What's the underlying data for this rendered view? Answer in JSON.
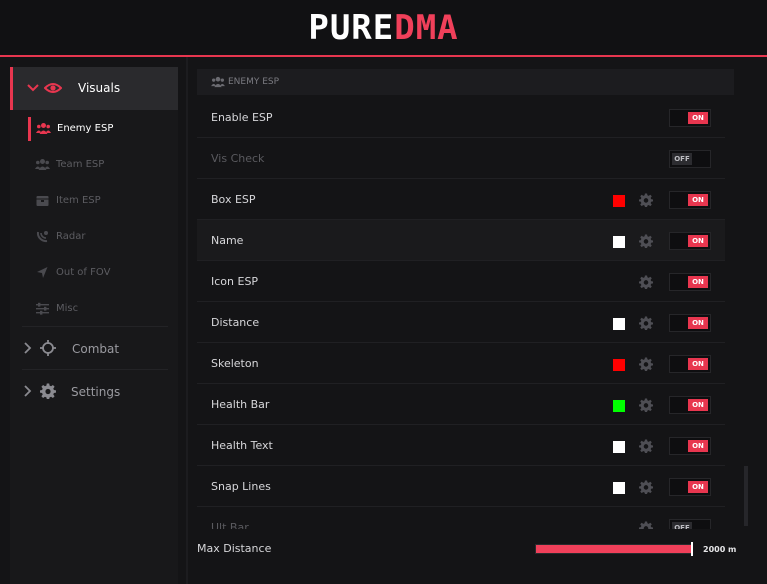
{
  "header": {
    "logo_white": "PURE",
    "logo_red": "DMA"
  },
  "sidebar": {
    "main": {
      "label": "Visuals",
      "icon": "eye-icon"
    },
    "sub_items": [
      {
        "label": "Enemy ESP",
        "icon": "users-icon",
        "active": true
      },
      {
        "label": "Team ESP",
        "icon": "users-icon",
        "active": false
      },
      {
        "label": "Item ESP",
        "icon": "box-icon",
        "active": false
      },
      {
        "label": "Radar",
        "icon": "radar-icon",
        "active": false
      },
      {
        "label": "Out of FOV",
        "icon": "arrow-icon",
        "active": false
      },
      {
        "label": "Misc",
        "icon": "sliders-icon",
        "active": false
      }
    ],
    "groups": [
      {
        "label": "Combat",
        "icon": "crosshair-icon"
      },
      {
        "label": "Settings",
        "icon": "gear-icon"
      }
    ]
  },
  "section": {
    "title": "ENEMY ESP"
  },
  "toggle_text": {
    "on": "ON",
    "off": "OFF"
  },
  "rows": [
    {
      "label": "Enable ESP",
      "toggle": true,
      "color": null,
      "gear": false,
      "dim": false
    },
    {
      "label": "Vis Check",
      "toggle": false,
      "color": null,
      "gear": false,
      "dim": true
    },
    {
      "label": "Box ESP",
      "toggle": true,
      "color": "#ff0000",
      "gear": true,
      "dim": false
    },
    {
      "label": "Name",
      "toggle": true,
      "color": "#ffffff",
      "gear": true,
      "dim": false
    },
    {
      "label": "Icon ESP",
      "toggle": true,
      "color": null,
      "gear": true,
      "dim": false
    },
    {
      "label": "Distance",
      "toggle": true,
      "color": "#ffffff",
      "gear": true,
      "dim": false
    },
    {
      "label": "Skeleton",
      "toggle": true,
      "color": "#ff0000",
      "gear": true,
      "dim": false
    },
    {
      "label": "Health Bar",
      "toggle": true,
      "color": "#00ff00",
      "gear": true,
      "dim": false
    },
    {
      "label": "Health Text",
      "toggle": true,
      "color": "#ffffff",
      "gear": true,
      "dim": false
    },
    {
      "label": "Snap Lines",
      "toggle": true,
      "color": "#ffffff",
      "gear": true,
      "dim": false
    },
    {
      "label": "Ult Bar",
      "toggle": false,
      "color": null,
      "gear": true,
      "dim": true
    }
  ],
  "slider": {
    "label": "Max Distance",
    "value_text": "2000 m",
    "fraction": 1.0
  },
  "colors": {
    "accent": "#e8364f",
    "background": "#141416"
  }
}
